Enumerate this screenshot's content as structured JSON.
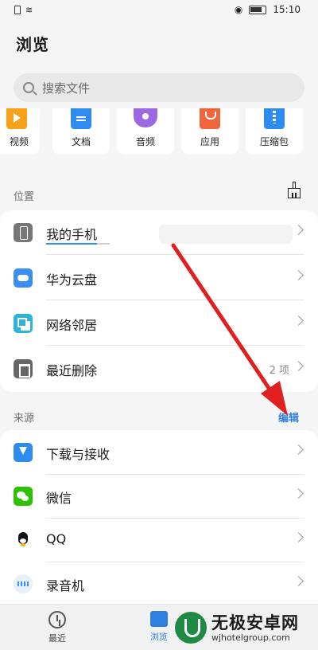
{
  "status_bar": {
    "time": "15:10"
  },
  "page": {
    "title": "浏览"
  },
  "search": {
    "placeholder": "搜索文件"
  },
  "categories": [
    {
      "label": "视频",
      "icon": "video-icon"
    },
    {
      "label": "文档",
      "icon": "document-icon"
    },
    {
      "label": "音频",
      "icon": "audio-icon"
    },
    {
      "label": "应用",
      "icon": "app-icon"
    },
    {
      "label": "压缩包",
      "icon": "archive-icon"
    }
  ],
  "location": {
    "title": "位置",
    "items": [
      {
        "label": "我的手机",
        "icon": "phone-icon",
        "storage_used_fraction": 0.8
      },
      {
        "label": "华为云盘",
        "icon": "cloud-icon"
      },
      {
        "label": "网络邻居",
        "icon": "network-icon"
      },
      {
        "label": "最近删除",
        "icon": "trash-icon",
        "count": "2 项"
      }
    ]
  },
  "sources": {
    "title": "来源",
    "edit_label": "编辑",
    "items": [
      {
        "label": "下载与接收",
        "icon": "download-icon"
      },
      {
        "label": "微信",
        "icon": "wechat-icon"
      },
      {
        "label": "QQ",
        "icon": "qq-icon"
      },
      {
        "label": "录音机",
        "icon": "recorder-icon"
      }
    ]
  },
  "bottom_nav": {
    "recent_label": "最近",
    "browse_label": "浏览"
  },
  "watermark": {
    "title": "无极安卓网",
    "url": "wjhotelgroup.com"
  },
  "colors": {
    "accent": "#2e7fe0",
    "annotation_arrow": "#e02020"
  }
}
